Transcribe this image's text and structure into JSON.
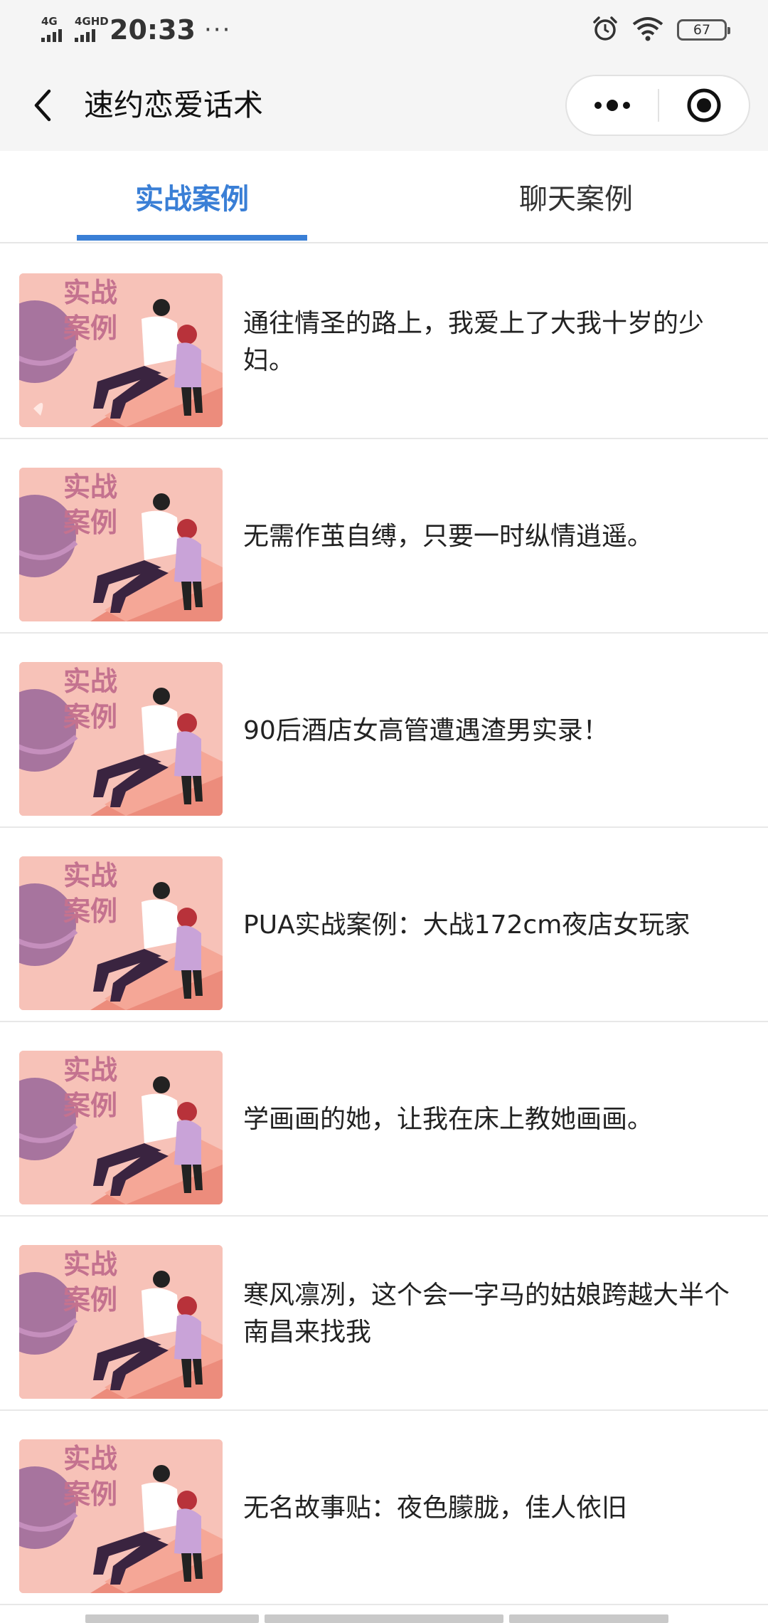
{
  "status_bar": {
    "net1_label": "4G",
    "net2_label": "4GHD",
    "time": "20:33",
    "dots": "···",
    "battery": "67"
  },
  "nav": {
    "title": "速约恋爱话术"
  },
  "tabs": [
    {
      "label": "实战案例",
      "active": true
    },
    {
      "label": "聊天案例",
      "active": false
    }
  ],
  "thumbnail_caption": [
    "实战",
    "案例"
  ],
  "items": [
    {
      "title": "通往情圣的路上，我爱上了大我十岁的少妇。"
    },
    {
      "title": "无需作茧自缚，只要一时纵情逍遥。"
    },
    {
      "title": "90后酒店女高管遭遇渣男实录！"
    },
    {
      "title": "PUA实战案例：大战172cm夜店女玩家"
    },
    {
      "title": "学画画的她，让我在床上教她画画。"
    },
    {
      "title": "寒风凛冽，这个会一字马的姑娘跨越大半个南昌来找我"
    },
    {
      "title": "无名故事贴：夜色朦胧，佳人依旧"
    }
  ],
  "colors": {
    "accent": "#3a7fd6",
    "thumb_bg": "#f7c2b8",
    "planet": "#a7749e"
  }
}
